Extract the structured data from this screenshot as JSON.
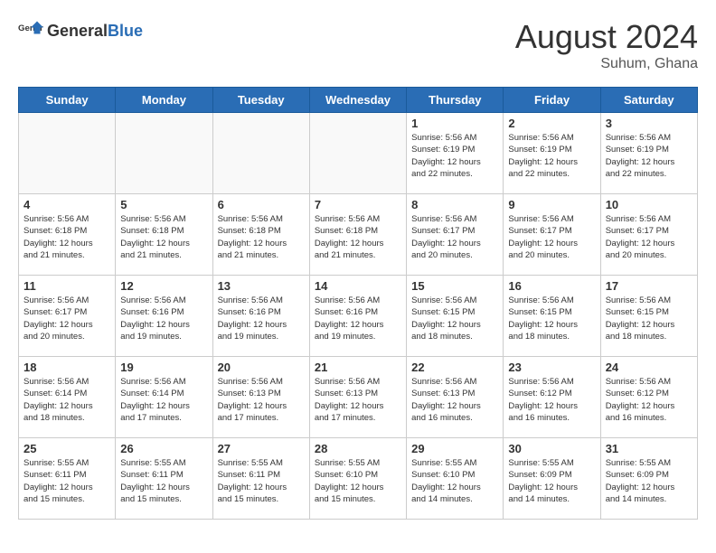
{
  "header": {
    "logo_general": "General",
    "logo_blue": "Blue",
    "title": "August 2024",
    "subtitle": "Suhum, Ghana"
  },
  "days_of_week": [
    "Sunday",
    "Monday",
    "Tuesday",
    "Wednesday",
    "Thursday",
    "Friday",
    "Saturday"
  ],
  "weeks": [
    [
      {
        "day": "",
        "detail": ""
      },
      {
        "day": "",
        "detail": ""
      },
      {
        "day": "",
        "detail": ""
      },
      {
        "day": "",
        "detail": ""
      },
      {
        "day": "1",
        "detail": "Sunrise: 5:56 AM\nSunset: 6:19 PM\nDaylight: 12 hours\nand 22 minutes."
      },
      {
        "day": "2",
        "detail": "Sunrise: 5:56 AM\nSunset: 6:19 PM\nDaylight: 12 hours\nand 22 minutes."
      },
      {
        "day": "3",
        "detail": "Sunrise: 5:56 AM\nSunset: 6:19 PM\nDaylight: 12 hours\nand 22 minutes."
      }
    ],
    [
      {
        "day": "4",
        "detail": "Sunrise: 5:56 AM\nSunset: 6:18 PM\nDaylight: 12 hours\nand 21 minutes."
      },
      {
        "day": "5",
        "detail": "Sunrise: 5:56 AM\nSunset: 6:18 PM\nDaylight: 12 hours\nand 21 minutes."
      },
      {
        "day": "6",
        "detail": "Sunrise: 5:56 AM\nSunset: 6:18 PM\nDaylight: 12 hours\nand 21 minutes."
      },
      {
        "day": "7",
        "detail": "Sunrise: 5:56 AM\nSunset: 6:18 PM\nDaylight: 12 hours\nand 21 minutes."
      },
      {
        "day": "8",
        "detail": "Sunrise: 5:56 AM\nSunset: 6:17 PM\nDaylight: 12 hours\nand 20 minutes."
      },
      {
        "day": "9",
        "detail": "Sunrise: 5:56 AM\nSunset: 6:17 PM\nDaylight: 12 hours\nand 20 minutes."
      },
      {
        "day": "10",
        "detail": "Sunrise: 5:56 AM\nSunset: 6:17 PM\nDaylight: 12 hours\nand 20 minutes."
      }
    ],
    [
      {
        "day": "11",
        "detail": "Sunrise: 5:56 AM\nSunset: 6:17 PM\nDaylight: 12 hours\nand 20 minutes."
      },
      {
        "day": "12",
        "detail": "Sunrise: 5:56 AM\nSunset: 6:16 PM\nDaylight: 12 hours\nand 19 minutes."
      },
      {
        "day": "13",
        "detail": "Sunrise: 5:56 AM\nSunset: 6:16 PM\nDaylight: 12 hours\nand 19 minutes."
      },
      {
        "day": "14",
        "detail": "Sunrise: 5:56 AM\nSunset: 6:16 PM\nDaylight: 12 hours\nand 19 minutes."
      },
      {
        "day": "15",
        "detail": "Sunrise: 5:56 AM\nSunset: 6:15 PM\nDaylight: 12 hours\nand 18 minutes."
      },
      {
        "day": "16",
        "detail": "Sunrise: 5:56 AM\nSunset: 6:15 PM\nDaylight: 12 hours\nand 18 minutes."
      },
      {
        "day": "17",
        "detail": "Sunrise: 5:56 AM\nSunset: 6:15 PM\nDaylight: 12 hours\nand 18 minutes."
      }
    ],
    [
      {
        "day": "18",
        "detail": "Sunrise: 5:56 AM\nSunset: 6:14 PM\nDaylight: 12 hours\nand 18 minutes."
      },
      {
        "day": "19",
        "detail": "Sunrise: 5:56 AM\nSunset: 6:14 PM\nDaylight: 12 hours\nand 17 minutes."
      },
      {
        "day": "20",
        "detail": "Sunrise: 5:56 AM\nSunset: 6:13 PM\nDaylight: 12 hours\nand 17 minutes."
      },
      {
        "day": "21",
        "detail": "Sunrise: 5:56 AM\nSunset: 6:13 PM\nDaylight: 12 hours\nand 17 minutes."
      },
      {
        "day": "22",
        "detail": "Sunrise: 5:56 AM\nSunset: 6:13 PM\nDaylight: 12 hours\nand 16 minutes."
      },
      {
        "day": "23",
        "detail": "Sunrise: 5:56 AM\nSunset: 6:12 PM\nDaylight: 12 hours\nand 16 minutes."
      },
      {
        "day": "24",
        "detail": "Sunrise: 5:56 AM\nSunset: 6:12 PM\nDaylight: 12 hours\nand 16 minutes."
      }
    ],
    [
      {
        "day": "25",
        "detail": "Sunrise: 5:55 AM\nSunset: 6:11 PM\nDaylight: 12 hours\nand 15 minutes."
      },
      {
        "day": "26",
        "detail": "Sunrise: 5:55 AM\nSunset: 6:11 PM\nDaylight: 12 hours\nand 15 minutes."
      },
      {
        "day": "27",
        "detail": "Sunrise: 5:55 AM\nSunset: 6:11 PM\nDaylight: 12 hours\nand 15 minutes."
      },
      {
        "day": "28",
        "detail": "Sunrise: 5:55 AM\nSunset: 6:10 PM\nDaylight: 12 hours\nand 15 minutes."
      },
      {
        "day": "29",
        "detail": "Sunrise: 5:55 AM\nSunset: 6:10 PM\nDaylight: 12 hours\nand 14 minutes."
      },
      {
        "day": "30",
        "detail": "Sunrise: 5:55 AM\nSunset: 6:09 PM\nDaylight: 12 hours\nand 14 minutes."
      },
      {
        "day": "31",
        "detail": "Sunrise: 5:55 AM\nSunset: 6:09 PM\nDaylight: 12 hours\nand 14 minutes."
      }
    ]
  ]
}
